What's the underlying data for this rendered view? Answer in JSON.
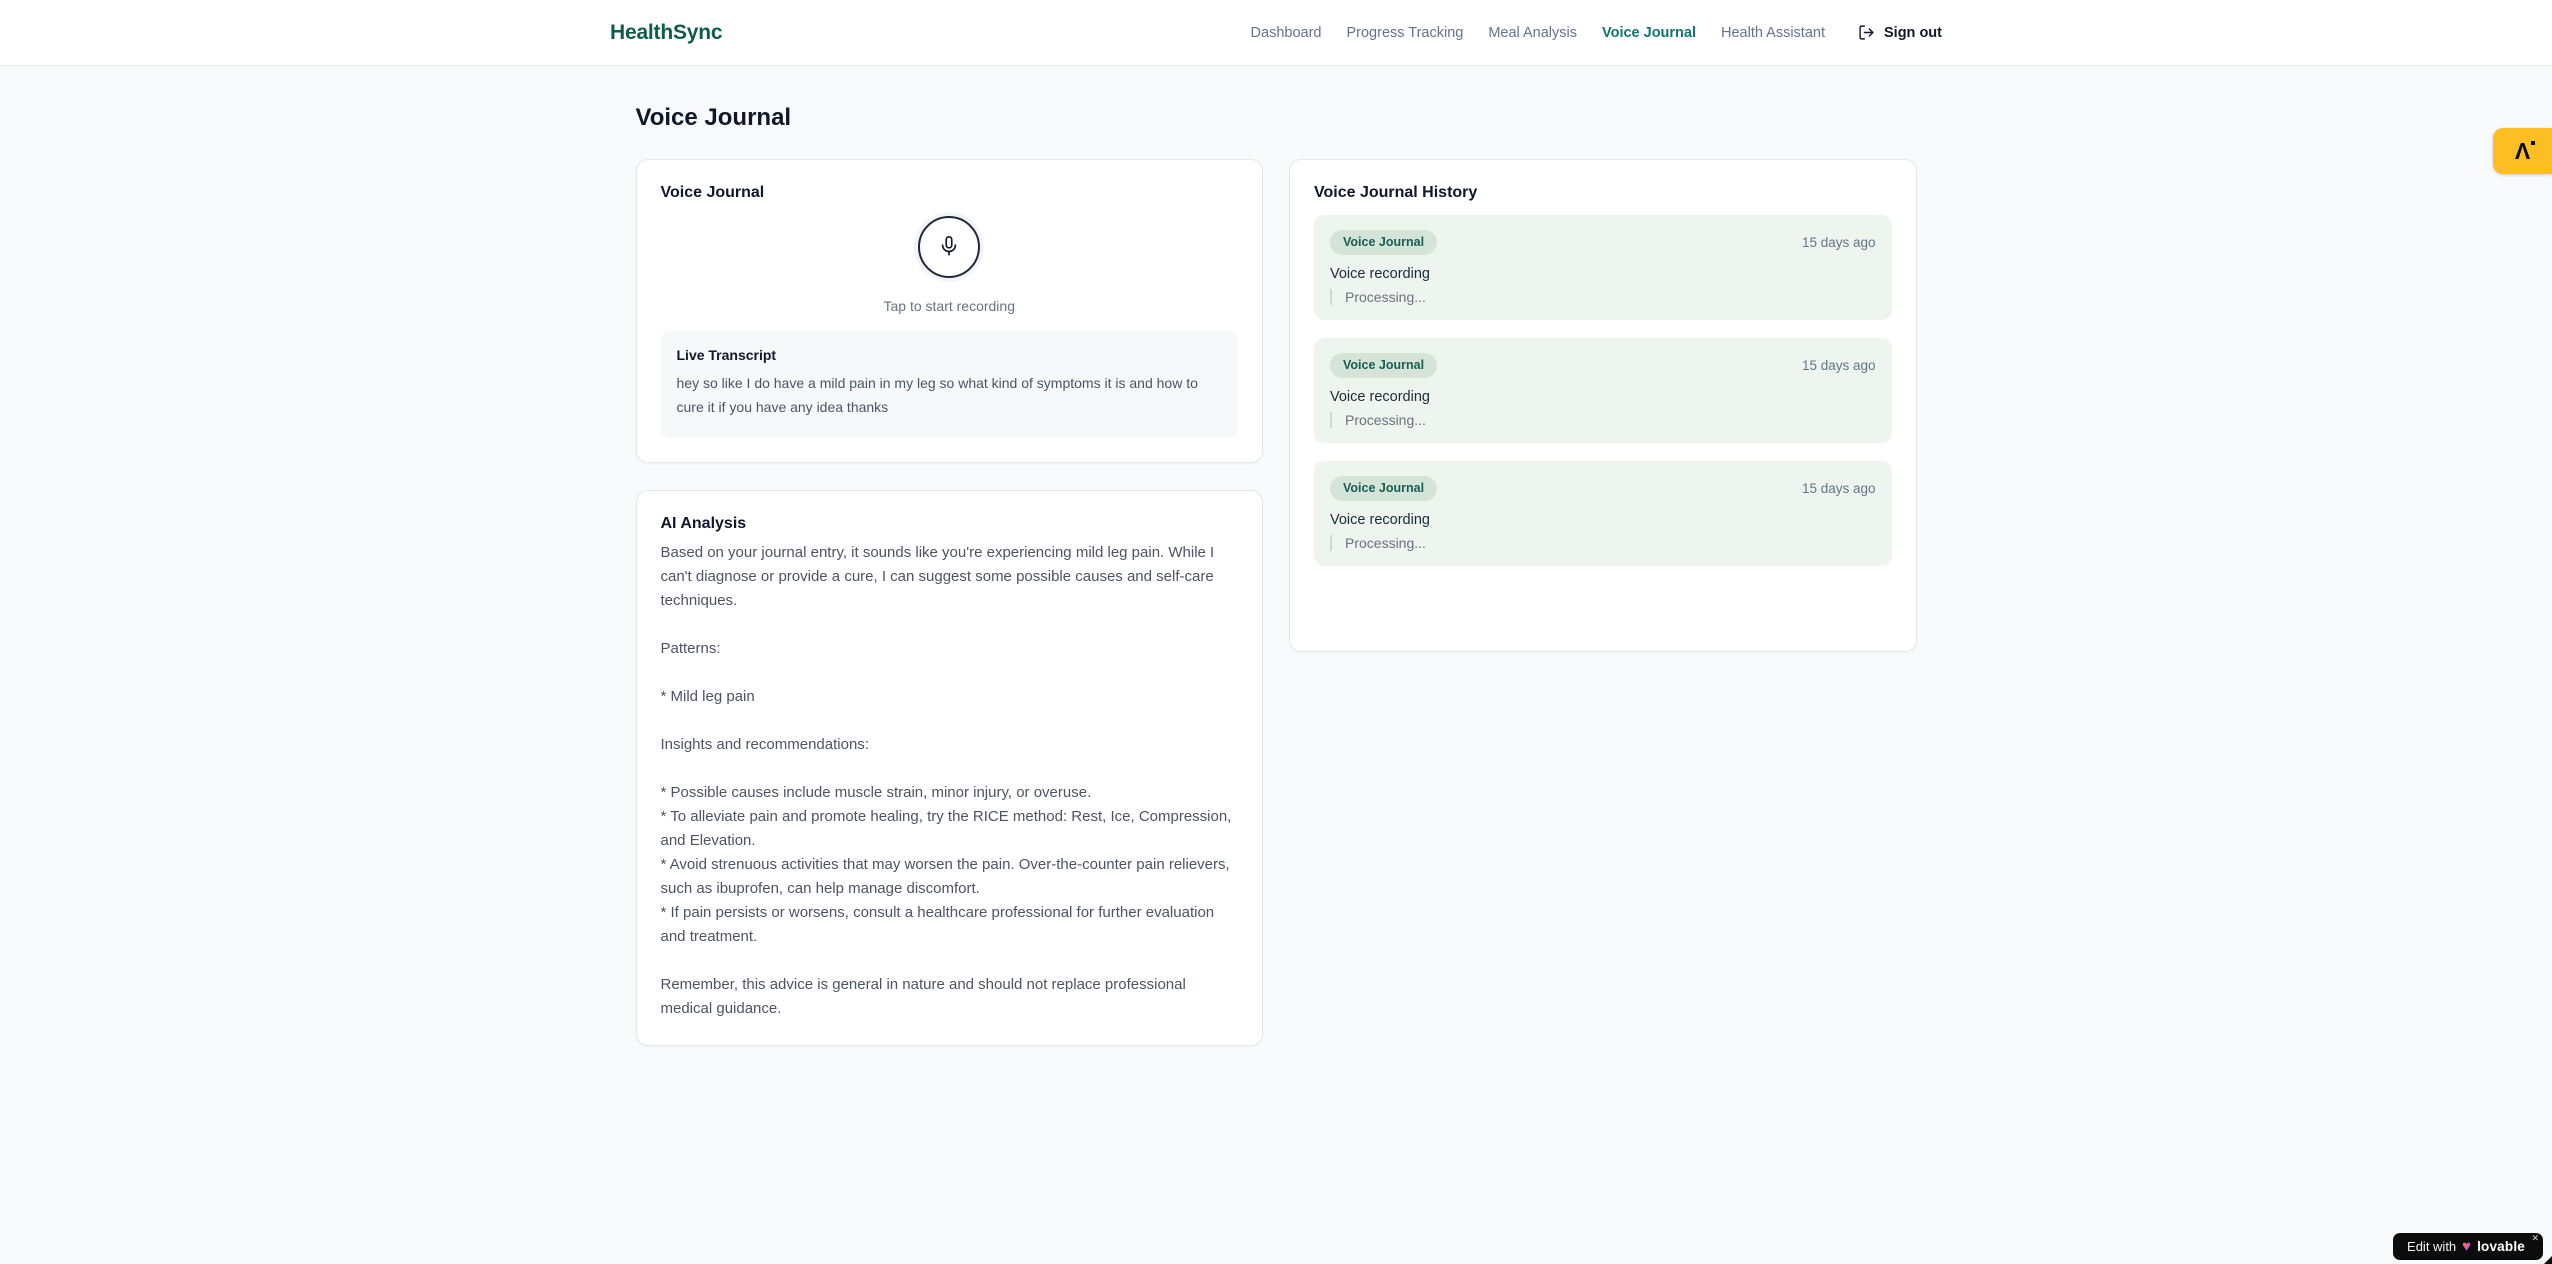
{
  "brand": {
    "name": "HealthSync"
  },
  "nav": {
    "items": [
      {
        "label": "Dashboard",
        "active": false
      },
      {
        "label": "Progress Tracking",
        "active": false
      },
      {
        "label": "Meal Analysis",
        "active": false
      },
      {
        "label": "Voice Journal",
        "active": true
      },
      {
        "label": "Health Assistant",
        "active": false
      }
    ],
    "signout_label": "Sign out"
  },
  "page": {
    "title": "Voice Journal"
  },
  "recorder": {
    "title": "Voice Journal",
    "hint": "Tap to start recording",
    "transcript_title": "Live Transcript",
    "transcript_text": "hey so like I do have a mild pain in my leg so what kind of symptoms it is and how to cure it if you have any idea thanks"
  },
  "analysis": {
    "title": "AI Analysis",
    "body": "Based on your journal entry, it sounds like you're experiencing mild leg pain. While I can't diagnose or provide a cure, I can suggest some possible causes and self-care techniques.\n\nPatterns:\n\n* Mild leg pain\n\nInsights and recommendations:\n\n* Possible causes include muscle strain, minor injury, or overuse.\n* To alleviate pain and promote healing, try the RICE method: Rest, Ice, Compression, and Elevation.\n* Avoid strenuous activities that may worsen the pain. Over-the-counter pain relievers, such as ibuprofen, can help manage discomfort.\n* If pain persists or worsens, consult a healthcare professional for further evaluation and treatment.\n\nRemember, this advice is general in nature and should not replace professional medical guidance."
  },
  "history": {
    "title": "Voice Journal History",
    "entries": [
      {
        "badge": "Voice Journal",
        "time": "15 days ago",
        "title": "Voice recording",
        "status": "Processing..."
      },
      {
        "badge": "Voice Journal",
        "time": "15 days ago",
        "title": "Voice recording",
        "status": "Processing..."
      },
      {
        "badge": "Voice Journal",
        "time": "15 days ago",
        "title": "Voice recording",
        "status": "Processing..."
      }
    ]
  },
  "floating": {
    "side_tab_glyph": "Λ",
    "badge": {
      "prefix": "Edit with",
      "heart": "♥",
      "brand": "lovable",
      "close": "✕"
    }
  },
  "colors": {
    "brand_green": "#0d5c4d",
    "nav_active": "#0f766e",
    "entry_bg": "#edf5ee",
    "pill_bg": "#d5e4d9",
    "pill_text": "#175e51",
    "side_tab_bg": "#fbbf24",
    "badge_bg": "#0c0c0d"
  }
}
